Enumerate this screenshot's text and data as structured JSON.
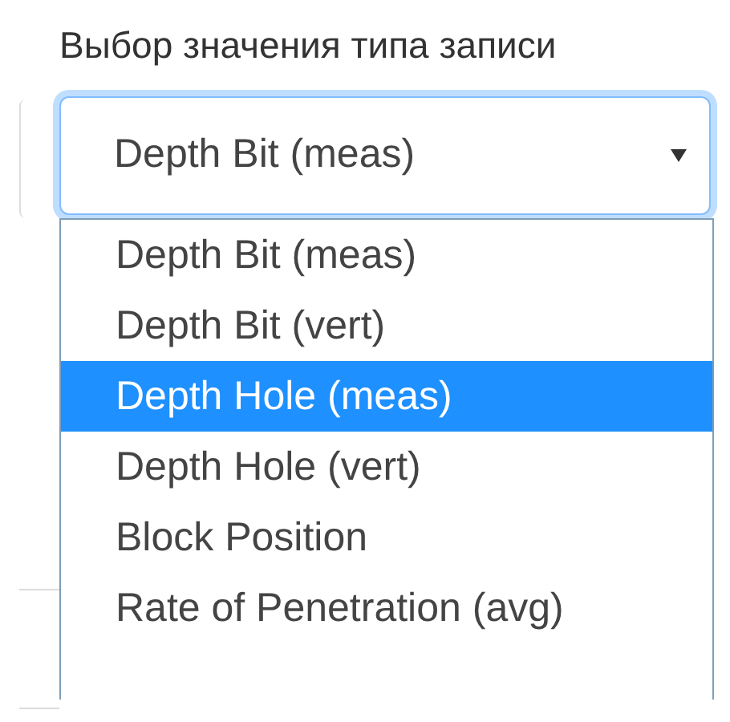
{
  "field": {
    "label": "Выбор значения типа записи",
    "value": "Depth Bit (meas)",
    "expanded": true
  },
  "options": [
    {
      "label": "Depth Bit (meas)",
      "selected": false
    },
    {
      "label": "Depth Bit (vert)",
      "selected": false
    },
    {
      "label": "Depth Hole (meas)",
      "selected": true
    },
    {
      "label": "Depth Hole (vert)",
      "selected": false
    },
    {
      "label": "Block Position",
      "selected": false
    },
    {
      "label": "Rate of Penetration (avg)",
      "selected": false
    }
  ]
}
